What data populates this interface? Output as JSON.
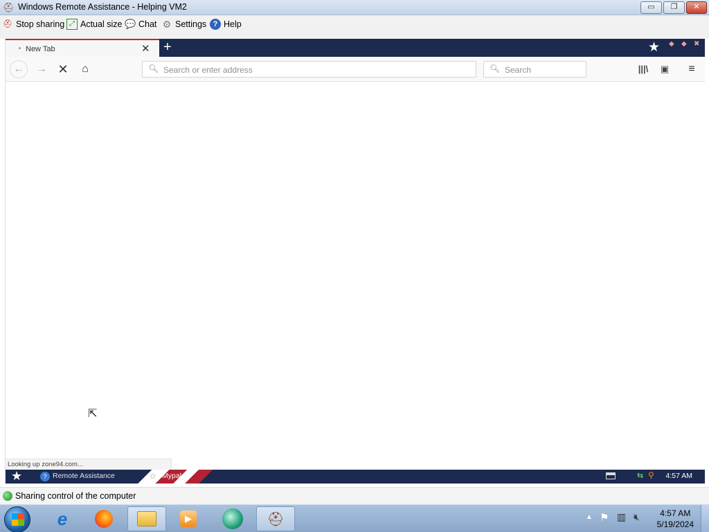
{
  "window": {
    "title": "Windows Remote Assistance - Helping VM2",
    "minimize": "▭",
    "restore": "❐",
    "close": "✕"
  },
  "toolbar": {
    "stop_sharing": "Stop sharing",
    "actual_size": "Actual size",
    "chat": "Chat",
    "settings": "Settings",
    "help": "Help"
  },
  "browser": {
    "tab_title": "New Tab",
    "url_placeholder": "Search or enter address",
    "search_placeholder": "Search",
    "status_text": "Looking up zone94.com..."
  },
  "remote_taskbar": {
    "items": [
      "Remote Assistance",
      "Mypal"
    ],
    "time": "4:57 AM"
  },
  "ra_status": {
    "text": "Sharing control of the computer"
  },
  "host_taskbar": {
    "time": "4:57 AM",
    "date": "5/19/2024"
  },
  "colors": {
    "tab_accent": "#c1272d",
    "navy": "#1b2a4e",
    "status_green": "#1e8a1e"
  }
}
